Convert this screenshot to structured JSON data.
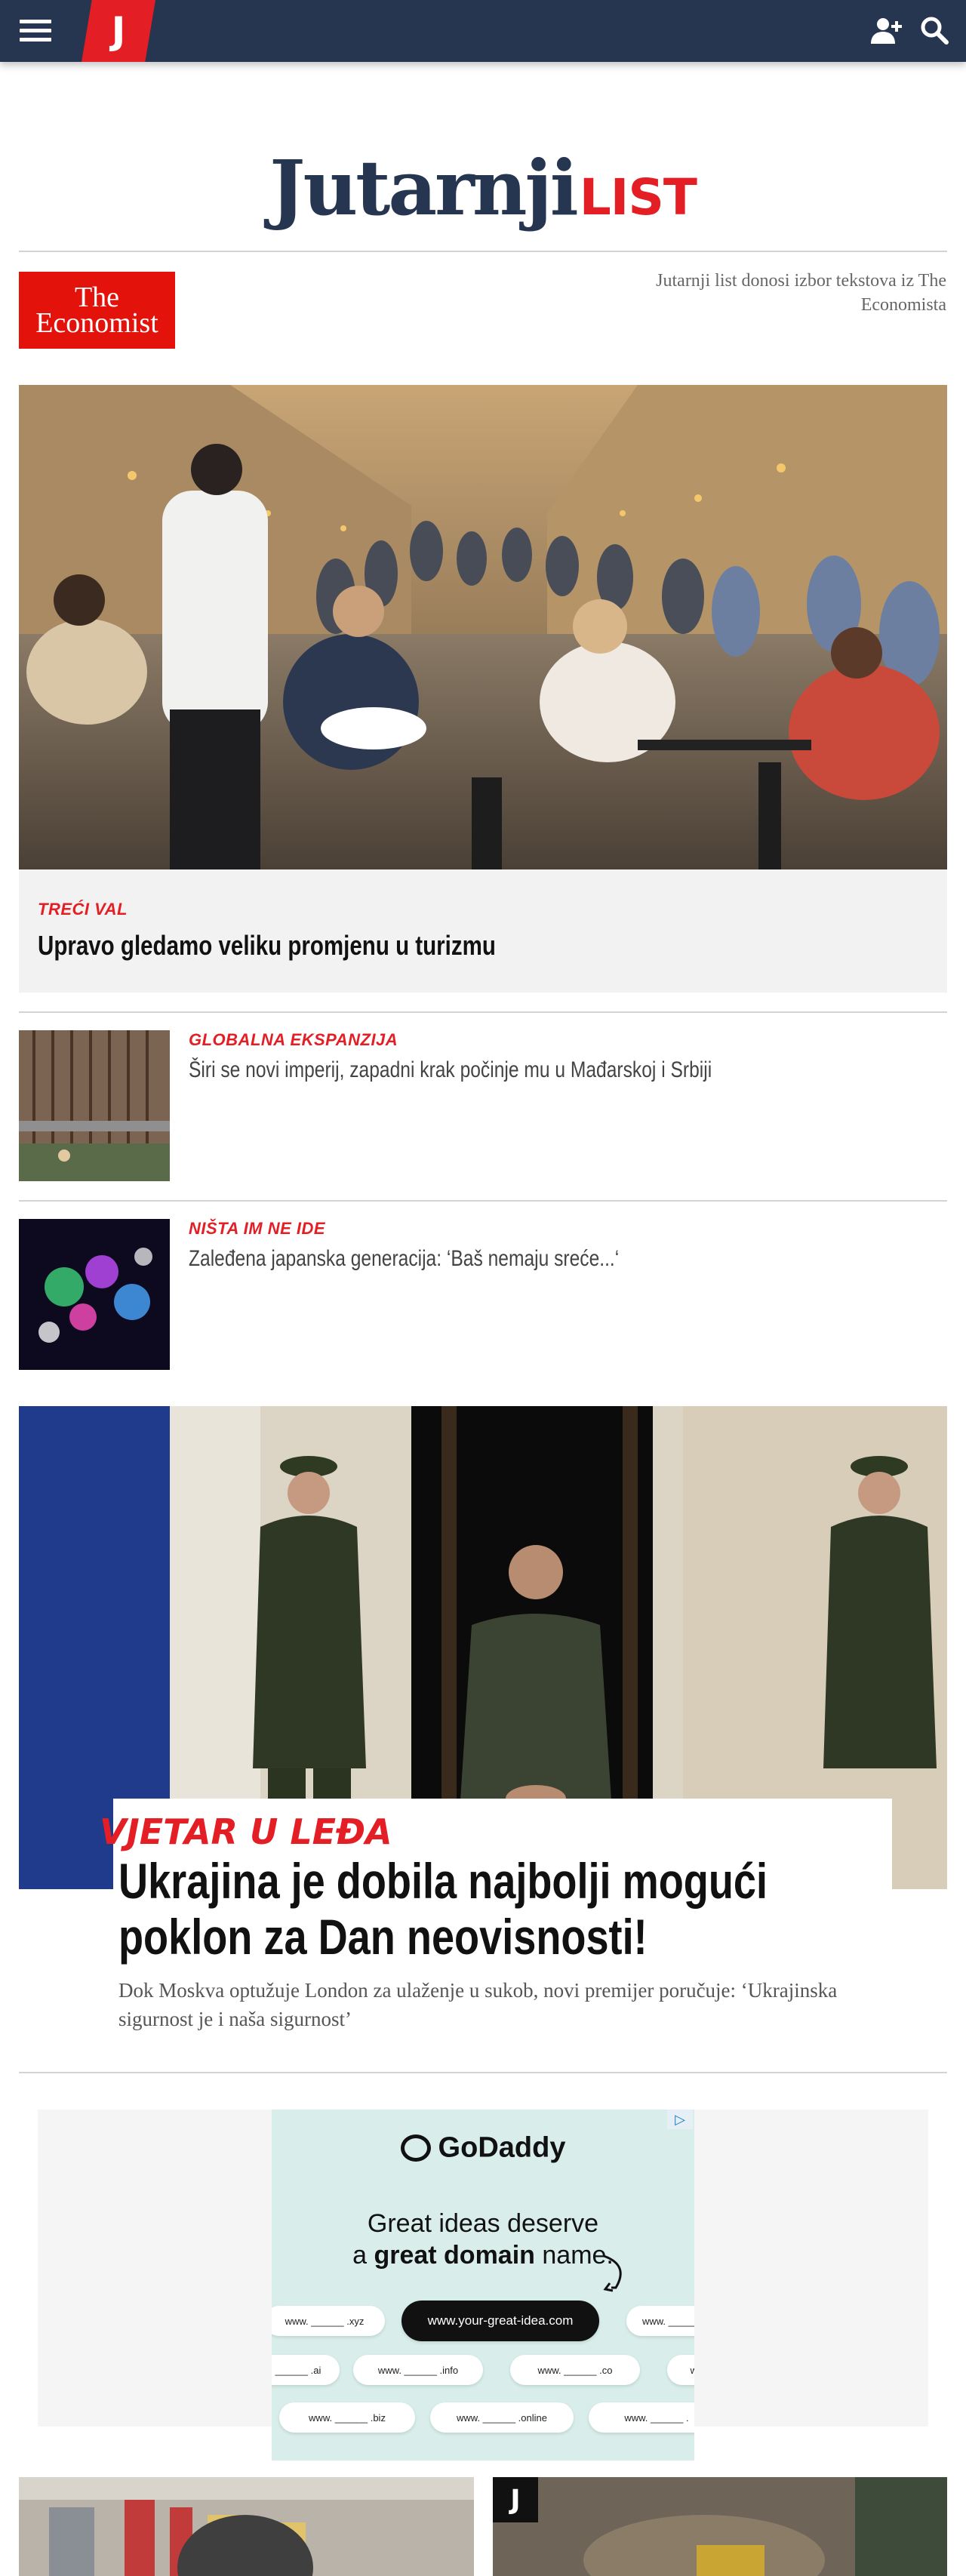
{
  "header": {
    "logo_letter": "J",
    "menu_icon": "hamburger-menu-icon",
    "user_icon": "user-add-icon",
    "search_icon": "search-icon"
  },
  "brand": {
    "name": "Jutarnji",
    "suffix": "LIST"
  },
  "partner": {
    "logo_line1": "The",
    "logo_line2": "Economist",
    "note": "Jutarnji list donosi izbor tekstova iz The Economista"
  },
  "hero": {
    "kicker": "TREĆI VAL",
    "title": "Upravo gledamo veliku promjenu u turizmu"
  },
  "stories": [
    {
      "kicker": "GLOBALNA EKSPANZIJA",
      "title": "Širi se novi imperij, zapadni krak počinje mu u Mađarskoj i Srbiji"
    },
    {
      "kicker": "NIŠTA IM NE IDE",
      "title": "Zaleđena japanska generacija: ‘Baš nemaju sreće...‘"
    }
  ],
  "feature": {
    "kicker": "VJETAR U LEĐA",
    "title": "Ukrajina je dobila najbolji mogući poklon za Dan neovisnosti!",
    "lead": "Dok Moskva optužuje London za ulaženje u sukob, novi premijer poručuje: ‘Ukrajinska sigurnost je i naša sigurnost’"
  },
  "ad": {
    "brand": "GoDaddy",
    "headline_1": "Great ideas deserve",
    "headline_2a": "a ",
    "headline_2b": "great domain",
    "headline_2c": " name.",
    "cta": "www.your-great-idea.com",
    "pills_row1": [
      "www. ______ .xyz",
      "www. ______"
    ],
    "pills_row2": [
      "______ .ai",
      "www. ______ .info",
      "www. ______ .co",
      "ww"
    ],
    "pills_row3": [
      "www. ______ .biz",
      "www. ______ .online",
      "www. ______ ."
    ],
    "adchoices_icon": "adchoices-icon"
  },
  "bottom_tile_logo": "J",
  "colors": {
    "navy": "#263550",
    "red": "#e31e24",
    "economist_red": "#e3120b"
  }
}
